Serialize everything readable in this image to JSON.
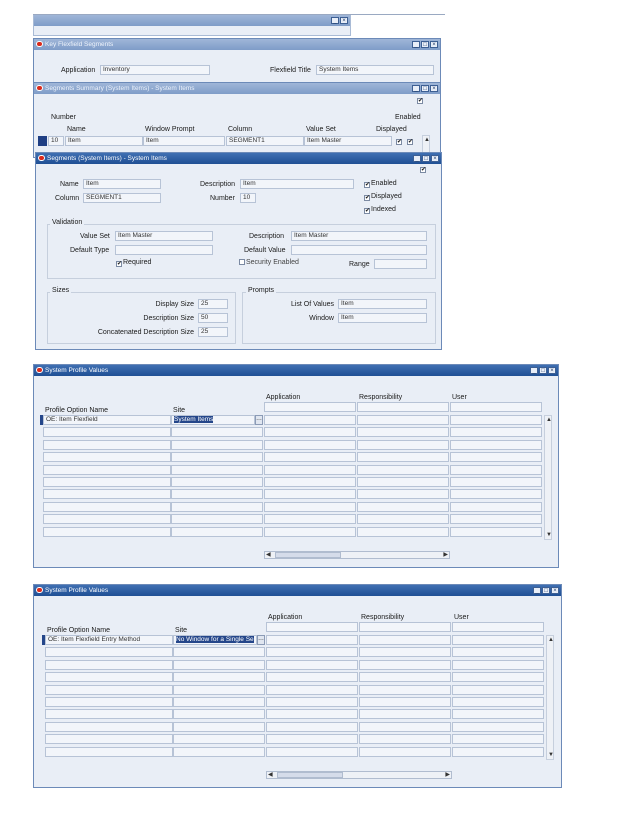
{
  "key_flexfield": {
    "title": "Key Flexfield Segments",
    "application_label": "Application",
    "application_value": "Inventory",
    "flexfield_title_label": "Flexfield Title",
    "flexfield_title_value": "System Items"
  },
  "segments_summary": {
    "title": "Segments Summary (System Items) - System Items",
    "number_label": "Number",
    "enabled_label": "Enabled",
    "columns": [
      "Name",
      "Window Prompt",
      "Column",
      "Value Set",
      "Displayed"
    ],
    "row": {
      "number": "10",
      "name": "Item",
      "window_prompt": "Item",
      "column": "SEGMENT1",
      "value_set": "Item Master"
    }
  },
  "segments": {
    "title": "Segments (System Items) - System Items",
    "name_label": "Name",
    "name_value": "Item",
    "column_label": "Column",
    "column_value": "SEGMENT1",
    "description_label": "Description",
    "description_value": "Item",
    "number_label": "Number",
    "number_value": "10",
    "enabled_label": "Enabled",
    "displayed_label": "Displayed",
    "indexed_label": "Indexed",
    "validation": {
      "group_label": "Validation",
      "value_set_label": "Value Set",
      "value_set_value": "Item Master",
      "default_type_label": "Default Type",
      "description_label": "Description",
      "description_value": "Item Master",
      "default_value_label": "Default Value",
      "required_label": "Required",
      "security_enabled_label": "Security Enabled",
      "range_label": "Range"
    },
    "sizes": {
      "group_label": "Sizes",
      "display_size_label": "Display Size",
      "display_size_value": "25",
      "description_size_label": "Description Size",
      "description_size_value": "50",
      "concat_size_label": "Concatenated Description Size",
      "concat_size_value": "25"
    },
    "prompts": {
      "group_label": "Prompts",
      "lov_label": "List Of Values",
      "lov_value": "Item",
      "window_label": "Window",
      "window_value": "Item"
    }
  },
  "profile1": {
    "title": "System Profile Values",
    "col_profile": "Profile Option Name",
    "col_site": "Site",
    "col_application": "Application",
    "col_responsibility": "Responsibility",
    "col_user": "User",
    "row_name": "OE: Item Flexfield",
    "row_site": "System Items"
  },
  "profile2": {
    "title": "System Profile Values",
    "col_profile": "Profile Option Name",
    "col_site": "Site",
    "col_application": "Application",
    "col_responsibility": "Responsibility",
    "col_user": "User",
    "row_name": "OE: Item Flexfield Entry Method",
    "row_site": "No Window for a Single Se"
  },
  "icons": {
    "minimize": "minimize-icon",
    "maximize": "maximize-icon",
    "close": "close-icon",
    "checkmark": "check-icon"
  },
  "colors": {
    "titlebar_active": "#1f4f94",
    "titlebar_inactive": "#7e9cc8",
    "window_bg": "#e9eef6",
    "field_bg": "#f2f5fa",
    "selection": "#24468a",
    "oracle_red": "#d92a1c"
  }
}
